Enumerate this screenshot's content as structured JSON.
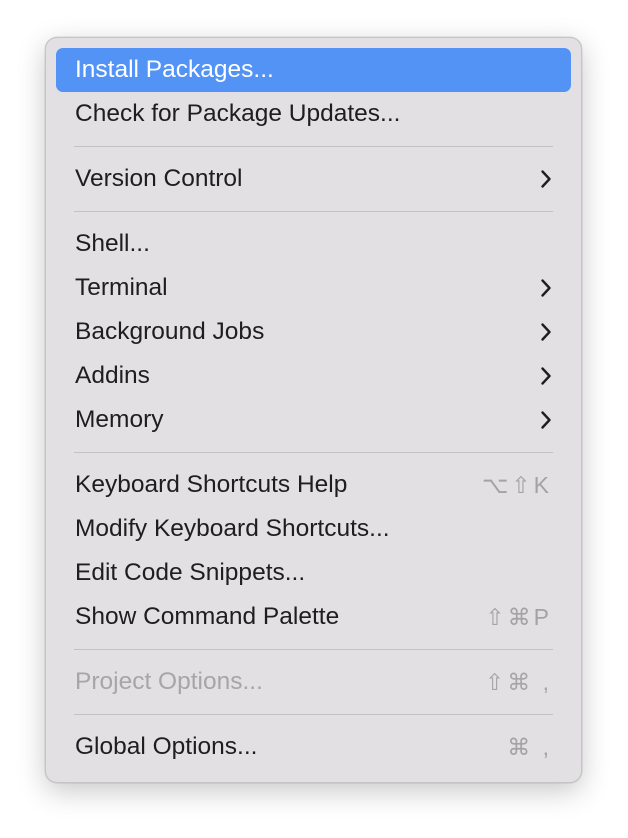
{
  "menu": {
    "items": [
      {
        "label": "Install Packages...",
        "shortcut": "",
        "submenu": false,
        "selected": true,
        "disabled": false
      },
      {
        "label": "Check for Package Updates...",
        "shortcut": "",
        "submenu": false,
        "selected": false,
        "disabled": false
      },
      {
        "label": "Version Control",
        "shortcut": "",
        "submenu": true,
        "selected": false,
        "disabled": false
      },
      {
        "label": "Shell...",
        "shortcut": "",
        "submenu": false,
        "selected": false,
        "disabled": false
      },
      {
        "label": "Terminal",
        "shortcut": "",
        "submenu": true,
        "selected": false,
        "disabled": false
      },
      {
        "label": "Background Jobs",
        "shortcut": "",
        "submenu": true,
        "selected": false,
        "disabled": false
      },
      {
        "label": "Addins",
        "shortcut": "",
        "submenu": true,
        "selected": false,
        "disabled": false
      },
      {
        "label": "Memory",
        "shortcut": "",
        "submenu": true,
        "selected": false,
        "disabled": false
      },
      {
        "label": "Keyboard Shortcuts Help",
        "shortcut": "⌥⇧K",
        "submenu": false,
        "selected": false,
        "disabled": false
      },
      {
        "label": "Modify Keyboard Shortcuts...",
        "shortcut": "",
        "submenu": false,
        "selected": false,
        "disabled": false
      },
      {
        "label": "Edit Code Snippets...",
        "shortcut": "",
        "submenu": false,
        "selected": false,
        "disabled": false
      },
      {
        "label": "Show Command Palette",
        "shortcut": "⇧⌘P",
        "submenu": false,
        "selected": false,
        "disabled": false
      },
      {
        "label": "Project Options...",
        "shortcut": "⇧⌘ ,",
        "submenu": false,
        "selected": false,
        "disabled": true
      },
      {
        "label": "Global Options...",
        "shortcut": "⌘ ,",
        "submenu": false,
        "selected": false,
        "disabled": false
      }
    ]
  },
  "colors": {
    "menu_background": "#e2e0e2",
    "selection_background": "#5393f5",
    "text": "#1e1e1e",
    "disabled_text": "#a7a5a7",
    "separator": "#c3c1c3"
  },
  "icons": {
    "submenu_indicator": "chevron-right-icon"
  }
}
